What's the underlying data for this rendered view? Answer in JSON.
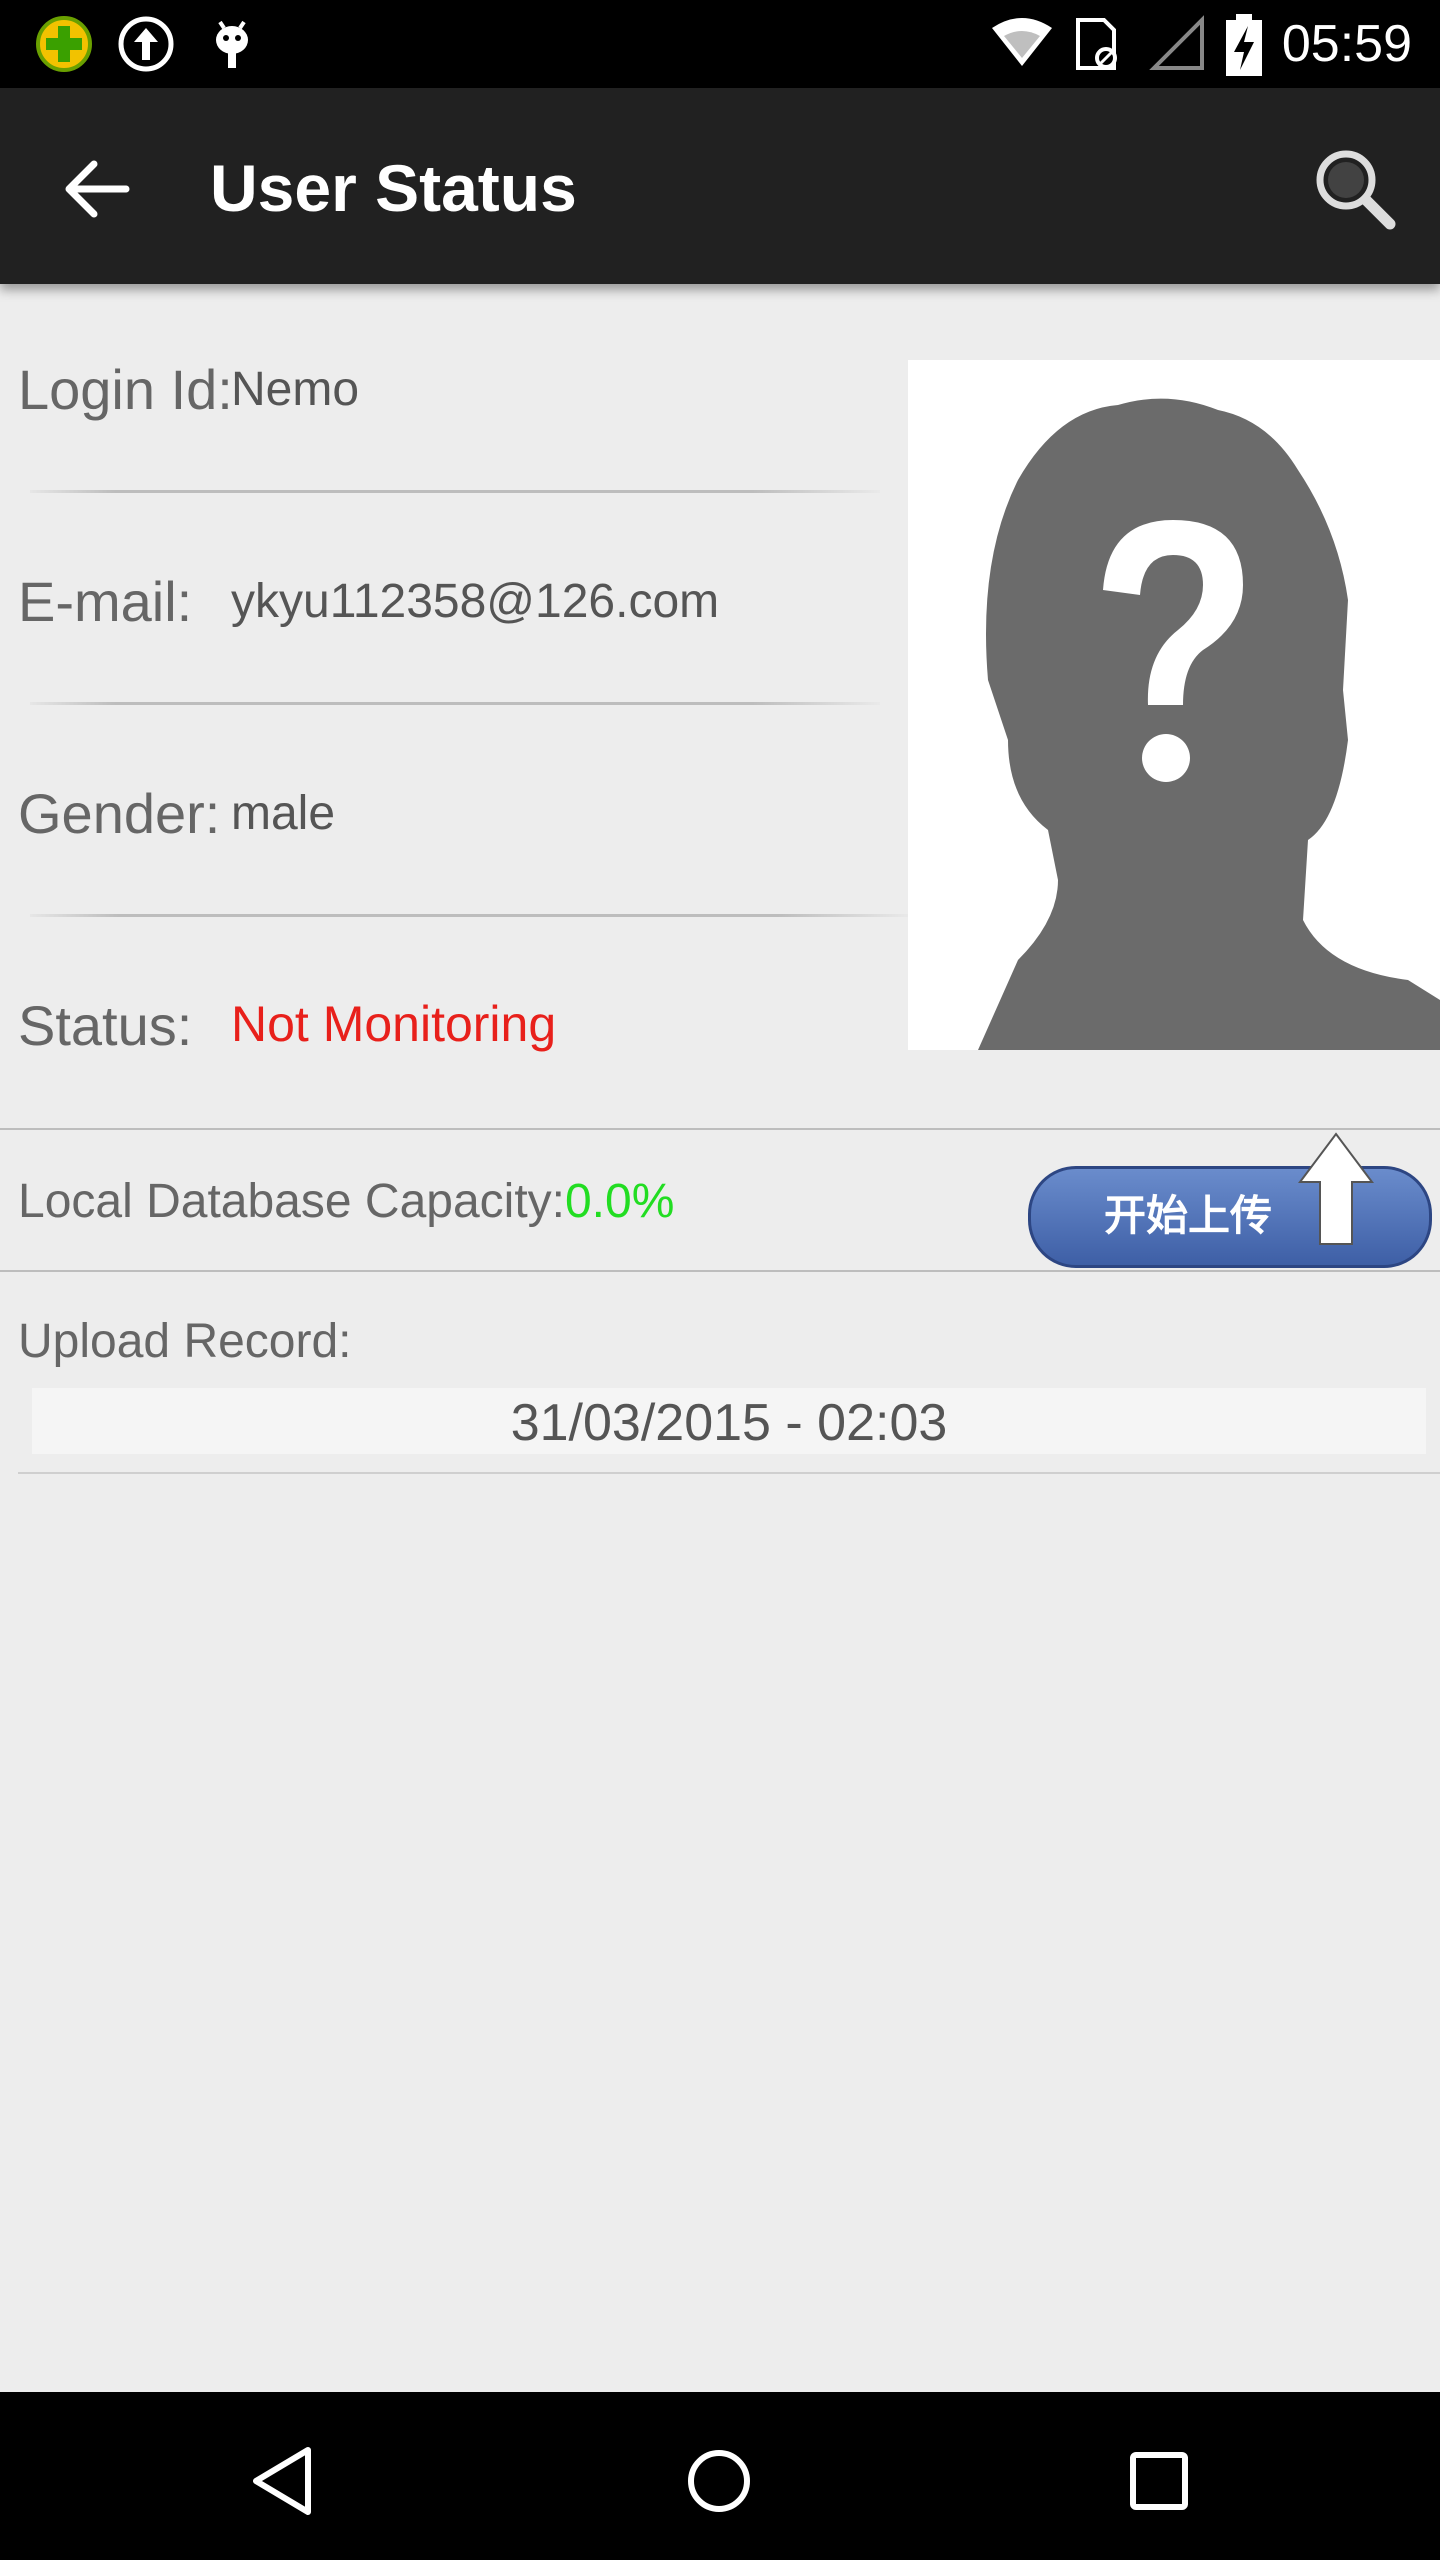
{
  "status_bar": {
    "time": "05:59",
    "icons": [
      "app-badge-icon",
      "upload-circle-icon",
      "android-debug-icon",
      "wifi-icon",
      "sim-card-icon",
      "signal-icon",
      "battery-charging-icon"
    ]
  },
  "app_bar": {
    "title": "User Status",
    "back_icon": "arrow-back-icon",
    "search_icon": "search-icon"
  },
  "profile": {
    "login_label": "Login Id:",
    "login_value": "Nemo",
    "email_label": "E-mail:",
    "email_value": "ykyu112358@126.com",
    "gender_label": "Gender:",
    "gender_value": "male",
    "status_label": "Status:",
    "status_value": "Not Monitoring",
    "status_color": "#e8201b",
    "avatar_icon": "unknown-user-silhouette-icon"
  },
  "database": {
    "capacity_label": "Local Database Capacity:",
    "capacity_value": "0.0%",
    "capacity_color": "#22dd22",
    "upload_button_label": "开始上传",
    "upload_button_color": "#4a6db5"
  },
  "upload_record": {
    "label": "Upload Record:",
    "entries": [
      "31/03/2015 - 02:03"
    ]
  },
  "nav_bar": {
    "buttons": [
      "back-triangle-icon",
      "home-circle-icon",
      "recents-square-icon"
    ]
  }
}
